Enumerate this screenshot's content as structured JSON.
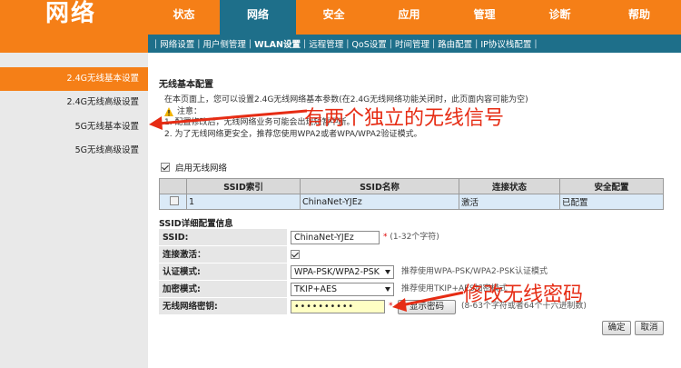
{
  "header": {
    "brand": "网络",
    "tabs": [
      {
        "label": "状态"
      },
      {
        "label": "网络",
        "active": true
      },
      {
        "label": "安全"
      },
      {
        "label": "应用"
      },
      {
        "label": "管理"
      },
      {
        "label": "诊断"
      },
      {
        "label": "帮助"
      }
    ]
  },
  "subnav": {
    "items": [
      "网络设置",
      "用户侧管理",
      "WLAN设置",
      "远程管理",
      "QoS设置",
      "时间管理",
      "路由配置",
      "IP协议栈配置"
    ],
    "active_index": 2
  },
  "sidebar": {
    "items": [
      "2.4G无线基本设置",
      "2.4G无线高级设置",
      "5G无线基本设置",
      "5G无线高级设置"
    ],
    "active_index": 0
  },
  "main": {
    "section_title": "无线基本配置",
    "help_line1": "在本页面上，您可以设置2.4G无线网络基本参数(在2.4G无线网络功能关闭时，此页面内容可能为空)",
    "note_title": "注意：",
    "note1": "1. 配置修改后，无线网络业务可能会出现短暂中断。",
    "note2": "2. 为了无线网络更安全，推荐您使用WPA2或者WPA/WPA2验证模式。",
    "enable_label": "启用无线网络",
    "enable_checked": true,
    "ssid_table": {
      "headers": [
        "",
        "SSID索引",
        "SSID名称",
        "连接状态",
        "安全配置"
      ],
      "rows": [
        [
          "",
          "1",
          "ChinaNet-YJEz",
          "激活",
          "已配置"
        ]
      ]
    },
    "detail_title": "SSID详细配置信息",
    "ssid_label": "SSID:",
    "ssid_value": "ChinaNet-YJEz",
    "ssid_hint": "(1-32个字符)",
    "active_label": "连接激活：",
    "active_checked": true,
    "auth_label": "认证模式:",
    "auth_value": "WPA-PSK/WPA2-PSK",
    "auth_hint": "推荐使用WPA-PSK/WPA2-PSK认证模式",
    "enc_label": "加密模式:",
    "enc_value": "TKIP+AES",
    "enc_hint": "推荐使用TKIP+AES加密模式",
    "key_label": "无线网络密钥:",
    "key_value": "••••••••••",
    "show_pw_button": "显示密码",
    "key_hint": "(8-63个字符或者64个十六进制数)",
    "ok_button": "确定",
    "cancel_button": "取消"
  },
  "annotations": {
    "top": "有两个独立的无线信号",
    "bottom": "修改无线密码",
    "color": "#e62c14"
  }
}
